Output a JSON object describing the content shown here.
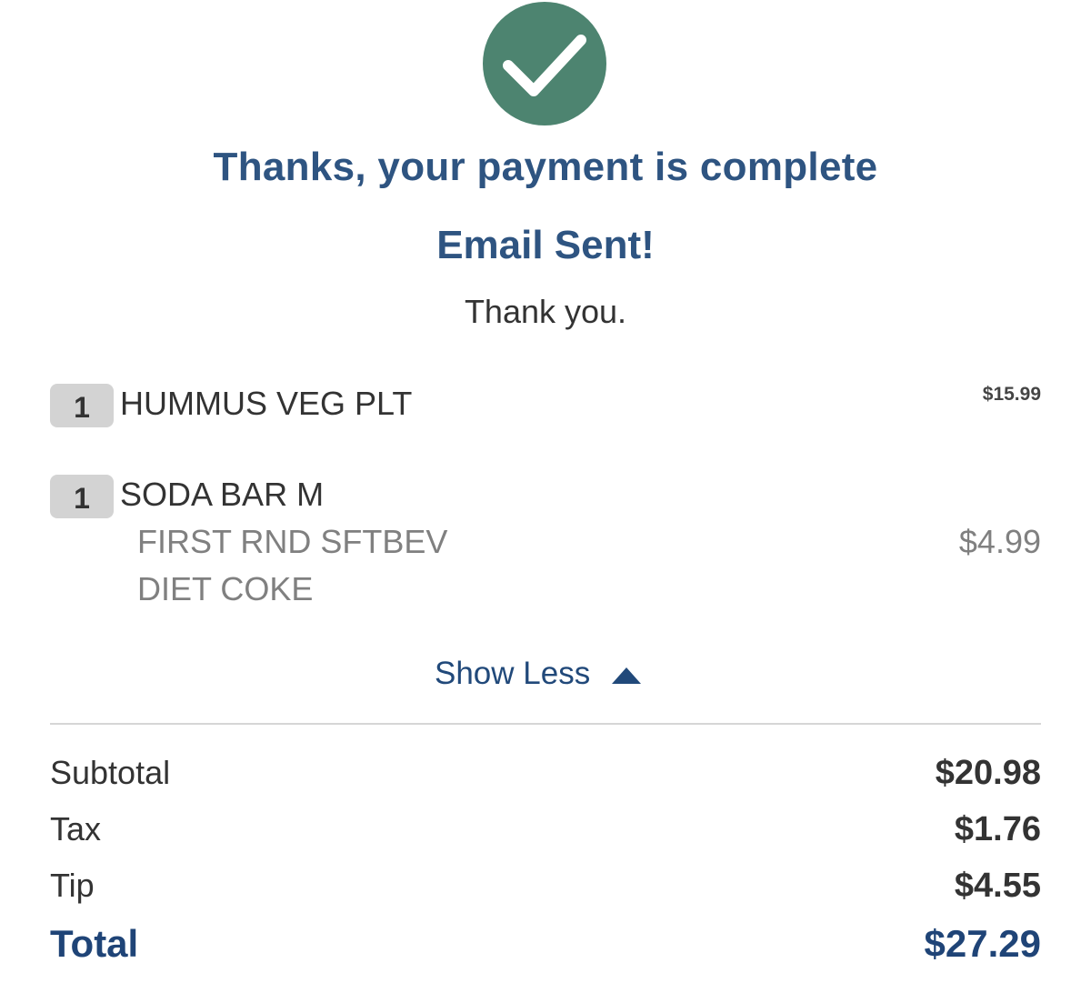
{
  "confirmation": {
    "icon": "checkmark-icon",
    "icon_color": "#4d8470",
    "heading": "Thanks, your payment is complete",
    "email_status": "Email Sent!",
    "thank_you": "Thank you."
  },
  "items": [
    {
      "quantity": "1",
      "name": "HUMMUS VEG PLT",
      "price": "$15.99",
      "modifiers": []
    },
    {
      "quantity": "1",
      "name": "SODA BAR M",
      "price": "$4.99",
      "modifiers": [
        "FIRST RND SFTBEV",
        "DIET COKE"
      ]
    }
  ],
  "toggle": {
    "label": "Show Less",
    "icon": "triangle-up-icon"
  },
  "summary": {
    "subtotal_label": "Subtotal",
    "subtotal_value": "$20.98",
    "tax_label": "Tax",
    "tax_value": "$1.76",
    "tip_label": "Tip",
    "tip_value": "$4.55",
    "total_label": "Total",
    "total_value": "$27.29"
  },
  "colors": {
    "heading": "#2e5481",
    "accent": "#1f4477",
    "success": "#4d8470"
  }
}
